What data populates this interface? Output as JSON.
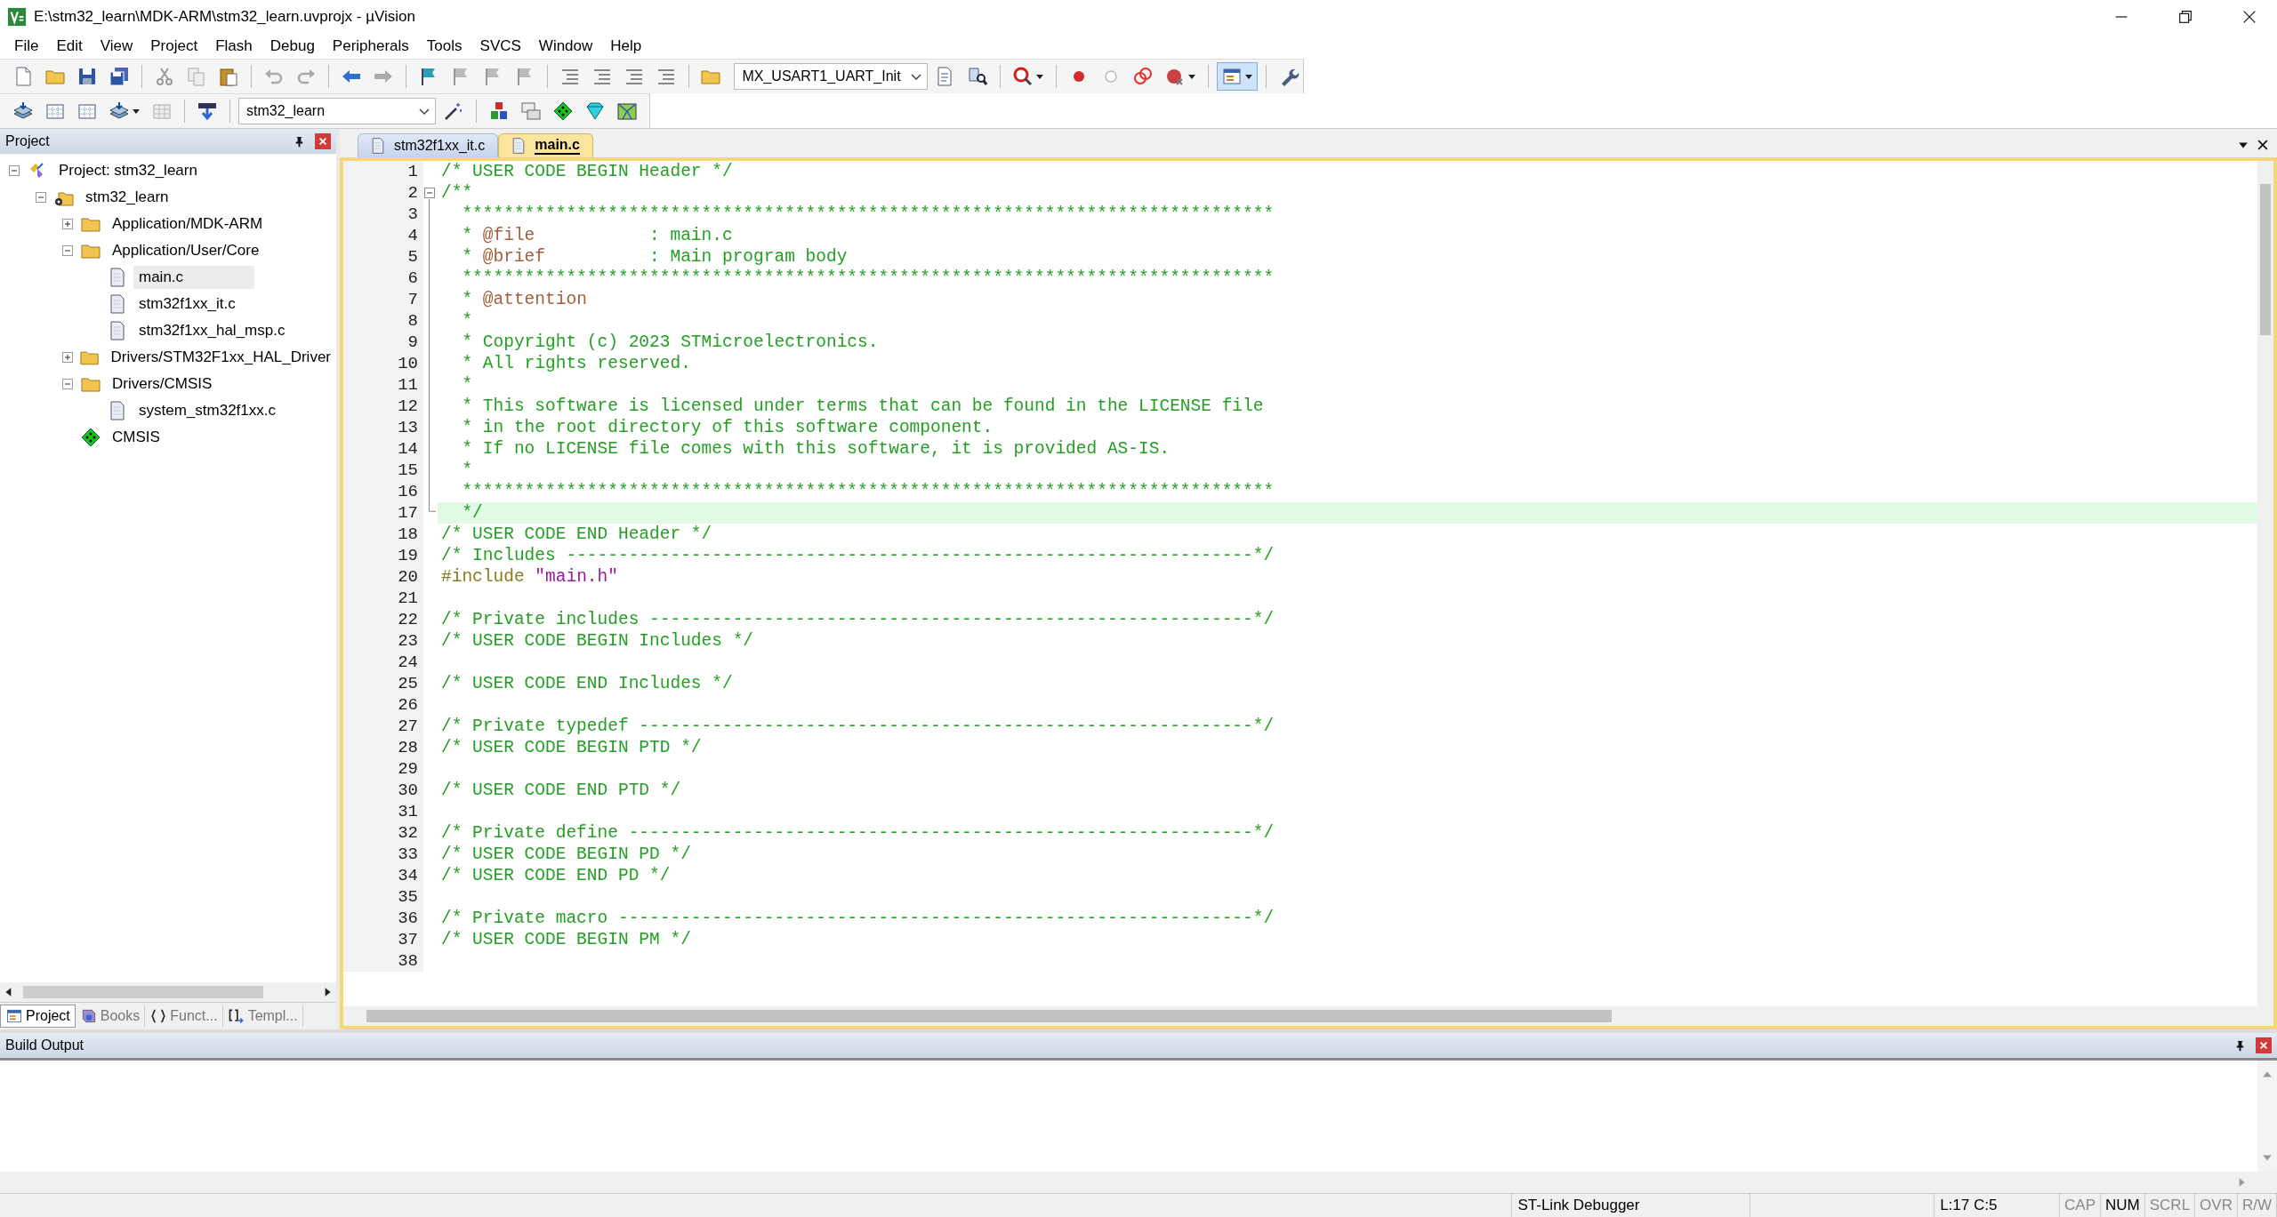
{
  "window": {
    "title": "E:\\stm32_learn\\MDK-ARM\\stm32_learn.uvprojx - µVision"
  },
  "menu": [
    "File",
    "Edit",
    "View",
    "Project",
    "Flash",
    "Debug",
    "Peripherals",
    "Tools",
    "SVCS",
    "Window",
    "Help"
  ],
  "toolbar": {
    "function_dropdown": {
      "value": "MX_USART1_UART_Init"
    },
    "target_dropdown": {
      "value": "stm32_learn"
    }
  },
  "project_panel": {
    "title": "Project",
    "tree": [
      {
        "label": "Project: stm32_learn",
        "kind": "project",
        "expanded": true,
        "selected": false,
        "children": [
          {
            "label": "stm32_learn",
            "kind": "target",
            "expanded": true,
            "selected": false,
            "children": [
              {
                "label": "Application/MDK-ARM",
                "kind": "folder",
                "expanded": false,
                "selected": false
              },
              {
                "label": "Application/User/Core",
                "kind": "folder",
                "expanded": true,
                "selected": false,
                "children": [
                  {
                    "label": "main.c",
                    "kind": "file",
                    "selected": true
                  },
                  {
                    "label": "stm32f1xx_it.c",
                    "kind": "file",
                    "selected": false
                  },
                  {
                    "label": "stm32f1xx_hal_msp.c",
                    "kind": "file",
                    "selected": false
                  }
                ]
              },
              {
                "label": "Drivers/STM32F1xx_HAL_Driver",
                "kind": "folder",
                "expanded": false,
                "selected": false
              },
              {
                "label": "Drivers/CMSIS",
                "kind": "folder",
                "expanded": true,
                "selected": false,
                "children": [
                  {
                    "label": "system_stm32f1xx.c",
                    "kind": "file",
                    "selected": false
                  }
                ]
              },
              {
                "label": "CMSIS",
                "kind": "component",
                "selected": false
              }
            ]
          }
        ]
      }
    ],
    "tabs": [
      {
        "label": "Project",
        "kind": "project",
        "selected": true
      },
      {
        "label": "Books",
        "kind": "books",
        "selected": false
      },
      {
        "label": "Funct...",
        "kind": "functions",
        "selected": false
      },
      {
        "label": "Templ...",
        "kind": "templates",
        "selected": false
      }
    ]
  },
  "editor": {
    "tabs": [
      {
        "label": "stm32f1xx_it.c",
        "selected": false
      },
      {
        "label": "main.c",
        "selected": true
      }
    ],
    "lines": [
      {
        "number": "1",
        "kind": "plain",
        "segments": [
          {
            "kind": "comment",
            "text": "/* USER CODE BEGIN Header */"
          }
        ]
      },
      {
        "number": "2",
        "kind": "fold_start",
        "expanded": true,
        "segments": [
          {
            "kind": "comment",
            "text": "/**"
          }
        ]
      },
      {
        "number": "3",
        "kind": "fold_inner",
        "segments": [
          {
            "kind": "comment",
            "text": "  ******************************************************************************"
          }
        ]
      },
      {
        "number": "4",
        "kind": "fold_inner",
        "segments": [
          {
            "kind": "comment",
            "text": "  * "
          },
          {
            "kind": "tag",
            "text": "@file"
          },
          {
            "kind": "comment",
            "text": "           : main.c"
          }
        ]
      },
      {
        "number": "5",
        "kind": "fold_inner",
        "segments": [
          {
            "kind": "comment",
            "text": "  * "
          },
          {
            "kind": "tag",
            "text": "@brief"
          },
          {
            "kind": "comment",
            "text": "          : Main program body"
          }
        ]
      },
      {
        "number": "6",
        "kind": "fold_inner",
        "segments": [
          {
            "kind": "comment",
            "text": "  ******************************************************************************"
          }
        ]
      },
      {
        "number": "7",
        "kind": "fold_inner",
        "segments": [
          {
            "kind": "comment",
            "text": "  * "
          },
          {
            "kind": "tag",
            "text": "@attention"
          }
        ]
      },
      {
        "number": "8",
        "kind": "fold_inner",
        "segments": [
          {
            "kind": "comment",
            "text": "  *"
          }
        ]
      },
      {
        "number": "9",
        "kind": "fold_inner",
        "segments": [
          {
            "kind": "comment",
            "text": "  * Copyright (c) 2023 STMicroelectronics."
          }
        ]
      },
      {
        "number": "10",
        "kind": "fold_inner",
        "segments": [
          {
            "kind": "comment",
            "text": "  * All rights reserved."
          }
        ]
      },
      {
        "number": "11",
        "kind": "fold_inner",
        "segments": [
          {
            "kind": "comment",
            "text": "  *"
          }
        ]
      },
      {
        "number": "12",
        "kind": "fold_inner",
        "segments": [
          {
            "kind": "comment",
            "text": "  * This software is licensed under terms that can be found in the LICENSE file"
          }
        ]
      },
      {
        "number": "13",
        "kind": "fold_inner",
        "segments": [
          {
            "kind": "comment",
            "text": "  * in the root directory of this software component."
          }
        ]
      },
      {
        "number": "14",
        "kind": "fold_inner",
        "segments": [
          {
            "kind": "comment",
            "text": "  * If no LICENSE file comes with this software, it is provided AS-IS."
          }
        ]
      },
      {
        "number": "15",
        "kind": "fold_inner",
        "segments": [
          {
            "kind": "comment",
            "text": "  *"
          }
        ]
      },
      {
        "number": "16",
        "kind": "fold_inner",
        "segments": [
          {
            "kind": "comment",
            "text": "  ******************************************************************************"
          }
        ]
      },
      {
        "number": "17",
        "kind": "fold_end",
        "current": true,
        "segments": [
          {
            "kind": "comment",
            "text": "  */"
          }
        ]
      },
      {
        "number": "18",
        "kind": "plain",
        "segments": [
          {
            "kind": "comment",
            "text": "/* USER CODE END Header */"
          }
        ]
      },
      {
        "number": "19",
        "kind": "plain",
        "segments": [
          {
            "kind": "comment",
            "text": "/* Includes ------------------------------------------------------------------*/"
          }
        ]
      },
      {
        "number": "20",
        "kind": "plain",
        "segments": [
          {
            "kind": "preproc",
            "text": "#include "
          },
          {
            "kind": "string",
            "text": "\"main.h\""
          }
        ]
      },
      {
        "number": "21",
        "kind": "plain"
      },
      {
        "number": "22",
        "kind": "plain",
        "segments": [
          {
            "kind": "comment",
            "text": "/* Private includes ----------------------------------------------------------*/"
          }
        ]
      },
      {
        "number": "23",
        "kind": "plain",
        "segments": [
          {
            "kind": "comment",
            "text": "/* USER CODE BEGIN Includes */"
          }
        ]
      },
      {
        "number": "24",
        "kind": "plain"
      },
      {
        "number": "25",
        "kind": "plain",
        "segments": [
          {
            "kind": "comment",
            "text": "/* USER CODE END Includes */"
          }
        ]
      },
      {
        "number": "26",
        "kind": "plain"
      },
      {
        "number": "27",
        "kind": "plain",
        "segments": [
          {
            "kind": "comment",
            "text": "/* Private typedef -----------------------------------------------------------*/"
          }
        ]
      },
      {
        "number": "28",
        "kind": "plain",
        "segments": [
          {
            "kind": "comment",
            "text": "/* USER CODE BEGIN PTD */"
          }
        ]
      },
      {
        "number": "29",
        "kind": "plain"
      },
      {
        "number": "30",
        "kind": "plain",
        "segments": [
          {
            "kind": "comment",
            "text": "/* USER CODE END PTD */"
          }
        ]
      },
      {
        "number": "31",
        "kind": "plain"
      },
      {
        "number": "32",
        "kind": "plain",
        "segments": [
          {
            "kind": "comment",
            "text": "/* Private define ------------------------------------------------------------*/"
          }
        ]
      },
      {
        "number": "33",
        "kind": "plain",
        "segments": [
          {
            "kind": "comment",
            "text": "/* USER CODE BEGIN PD */"
          }
        ]
      },
      {
        "number": "34",
        "kind": "plain",
        "segments": [
          {
            "kind": "comment",
            "text": "/* USER CODE END PD */"
          }
        ]
      },
      {
        "number": "35",
        "kind": "plain"
      },
      {
        "number": "36",
        "kind": "plain",
        "segments": [
          {
            "kind": "comment",
            "text": "/* Private macro -------------------------------------------------------------*/"
          }
        ]
      },
      {
        "number": "37",
        "kind": "plain",
        "segments": [
          {
            "kind": "comment",
            "text": "/* USER CODE BEGIN PM */"
          }
        ]
      },
      {
        "number": "38",
        "kind": "plain"
      }
    ]
  },
  "build_output": {
    "title": "Build Output"
  },
  "status_bar": {
    "debugger": "ST-Link Debugger",
    "position": "L:17 C:5",
    "indicators": [
      {
        "label": "CAP",
        "on": false
      },
      {
        "label": "NUM",
        "on": true
      },
      {
        "label": "SCRL",
        "on": false
      },
      {
        "label": "OVR",
        "on": false
      },
      {
        "label": "R/W",
        "on": false
      }
    ]
  }
}
